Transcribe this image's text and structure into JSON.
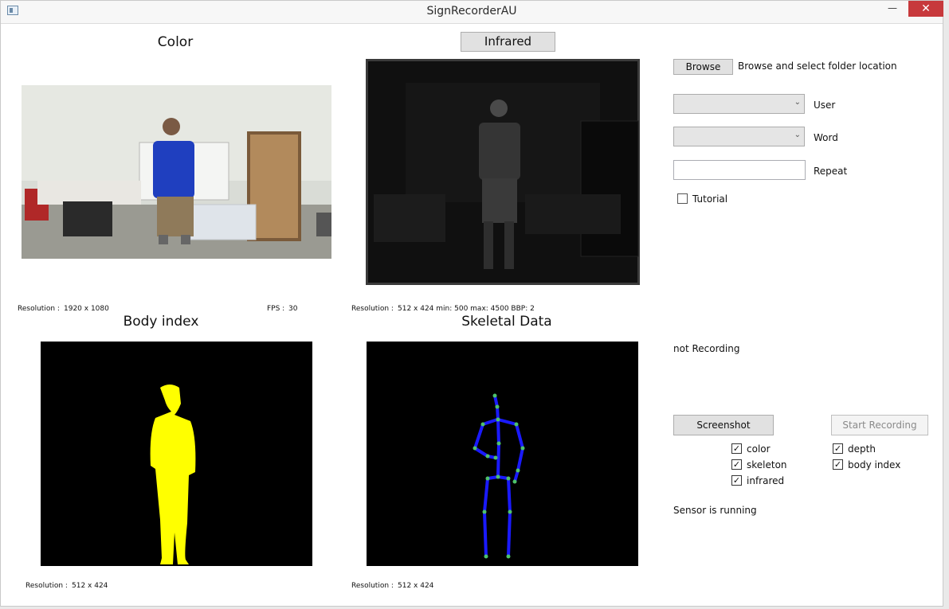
{
  "window": {
    "title": "SignRecorderAU",
    "minimize": "—",
    "maximize": "☐",
    "close": "✕"
  },
  "color_panel": {
    "title": "Color",
    "resolution_label": "Resolution :",
    "resolution_value": "1920 x 1080",
    "fps_label": "FPS :",
    "fps_value": "30"
  },
  "infrared_panel": {
    "title_button": "Infrared",
    "resolution_label": "Resolution :",
    "info": "512 x 424   min: 500  max: 4500 BBP: 2"
  },
  "body_index_panel": {
    "title": "Body index",
    "resolution_label": "Resolution :",
    "resolution_value": "512 x 424"
  },
  "skeletal_panel": {
    "title": "Skeletal Data",
    "resolution_label": "Resolution :",
    "resolution_value": "512 x 424"
  },
  "controls": {
    "browse_button": "Browse",
    "browse_hint": "Browse and select folder location",
    "user_label": "User",
    "user_value": "",
    "word_label": "Word",
    "word_value": "",
    "repeat_label": "Repeat",
    "repeat_value": "",
    "tutorial_label": "Tutorial",
    "tutorial_checked": false,
    "recording_status": "not Recording",
    "screenshot_button": "Screenshot",
    "start_recording_button": "Start Recording",
    "streams": [
      {
        "label": "color",
        "checked": true
      },
      {
        "label": "skeleton",
        "checked": true
      },
      {
        "label": "infrared",
        "checked": true
      },
      {
        "label": "depth",
        "checked": true
      },
      {
        "label": "body index",
        "checked": true
      }
    ],
    "sensor_status": "Sensor is running"
  },
  "colors": {
    "body_index_fill": "#ffff00",
    "skeleton_bone": "#1a1aff",
    "skeleton_joint": "#4ec26a",
    "close_button": "#c7393c"
  },
  "icons": [
    "app-icon",
    "minimize-icon",
    "maximize-icon",
    "close-icon",
    "chevron-down-icon",
    "checkmark-icon"
  ]
}
